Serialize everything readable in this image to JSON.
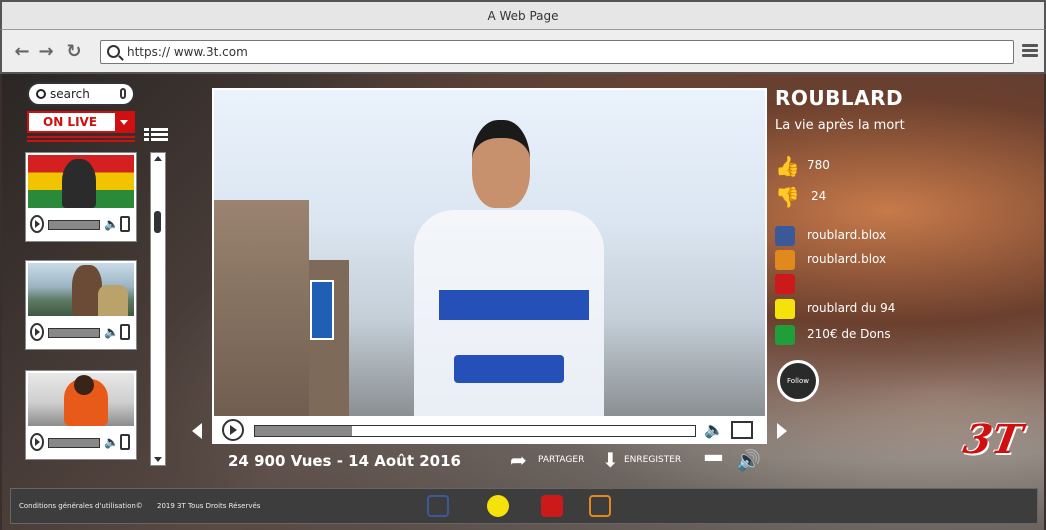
{
  "browser": {
    "title": "A Web Page",
    "url": "https://  www.3t.com"
  },
  "sidebar": {
    "search_placeholder": "search",
    "live_dropdown": "ON LIVE"
  },
  "video": {
    "views_date": "24 900 Vues - 14 Août 2016",
    "progress": 0.22,
    "share_label": "PARTAGER",
    "download_label": "ENREGISTER",
    "more_label": "■■■"
  },
  "artist": {
    "name": "ROUBLARD",
    "song": "La vie après la mort",
    "likes": "780",
    "dislikes": "24",
    "facebook": "roublard.blox",
    "instagram": "roublard.blox",
    "snapchat": "roublard du 94",
    "donations": "210€ de Dons",
    "follow_label": "Follow"
  },
  "footer": {
    "terms": "Conditions générales d'utilisation©",
    "rights": "2019 3T Tous Droits Réservés"
  },
  "logo": "3T",
  "colors": {
    "accent_red": "#d01010",
    "facebook": "#3b5998",
    "instagram": "#e08a1e",
    "youtube": "#cc1a1a",
    "snapchat": "#f5e20a",
    "money": "#1f9e3a"
  }
}
